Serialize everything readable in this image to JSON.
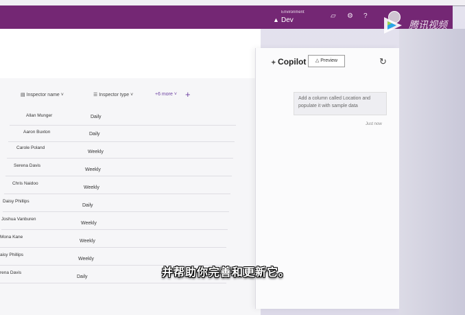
{
  "header": {
    "env_label": "Environment",
    "env_value": "Dev",
    "bell_icon": "bell-icon",
    "settings_icon": "gear-icon",
    "help_label": "?"
  },
  "table": {
    "columns": {
      "name": "Inspector name",
      "type": "Inspector type",
      "more": "+6 more",
      "add": "+"
    },
    "rows": [
      {
        "name": "Allan Munger",
        "type": "Daily"
      },
      {
        "name": "Aaron Buxton",
        "type": "Daily"
      },
      {
        "name": "Carole Poland",
        "type": "Weekly"
      },
      {
        "name": "Serena Davis",
        "type": "Weekly"
      },
      {
        "name": "Chris Naidoo",
        "type": "Weekly"
      },
      {
        "name": "Daisy Phillips",
        "type": "Daily"
      },
      {
        "name": "Joshua Vanburen",
        "type": "Weekly"
      },
      {
        "name": "Mona Kane",
        "type": "Weekly"
      },
      {
        "name": "aisy Phillips",
        "type": "Weekly"
      },
      {
        "name": "rena Davis",
        "type": "Daily"
      }
    ]
  },
  "copilot": {
    "title": "Copilot",
    "preview": "Preview",
    "message": "Add a column called Location and populate it with sample data",
    "time": "Just now"
  },
  "overlay": {
    "subtitle": "并帮助你完善和更新它。",
    "logo_text": "腾讯视频"
  }
}
